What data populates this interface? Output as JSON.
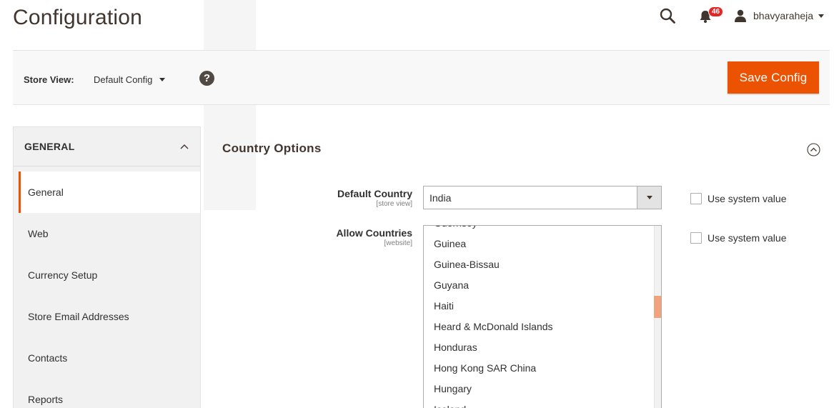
{
  "header": {
    "title": "Configuration",
    "notifications_count": "46",
    "user_name": "bhavyaraheja"
  },
  "store_bar": {
    "label": "Store View:",
    "selected": "Default Config",
    "help": "?",
    "save_label": "Save Config"
  },
  "sidebar": {
    "group_label": "GENERAL",
    "items": [
      {
        "label": "General",
        "active": true
      },
      {
        "label": "Web"
      },
      {
        "label": "Currency Setup"
      },
      {
        "label": "Store Email Addresses"
      },
      {
        "label": "Contacts"
      },
      {
        "label": "Reports"
      }
    ]
  },
  "section": {
    "title": "Country Options",
    "default_country": {
      "label": "Default Country",
      "scope": "[store view]",
      "value": "India",
      "use_system": "Use system value"
    },
    "allow_countries": {
      "label": "Allow Countries",
      "scope": "[website]",
      "use_system": "Use system value",
      "options": [
        "Guernsey",
        "Guinea",
        "Guinea-Bissau",
        "Guyana",
        "Haiti",
        "Heard & McDonald Islands",
        "Honduras",
        "Hong Kong SAR China",
        "Hungary",
        "Iceland"
      ],
      "scroll_position": 0.38
    }
  },
  "colors": {
    "accent": "#eb5202",
    "badge": "#e22626"
  }
}
